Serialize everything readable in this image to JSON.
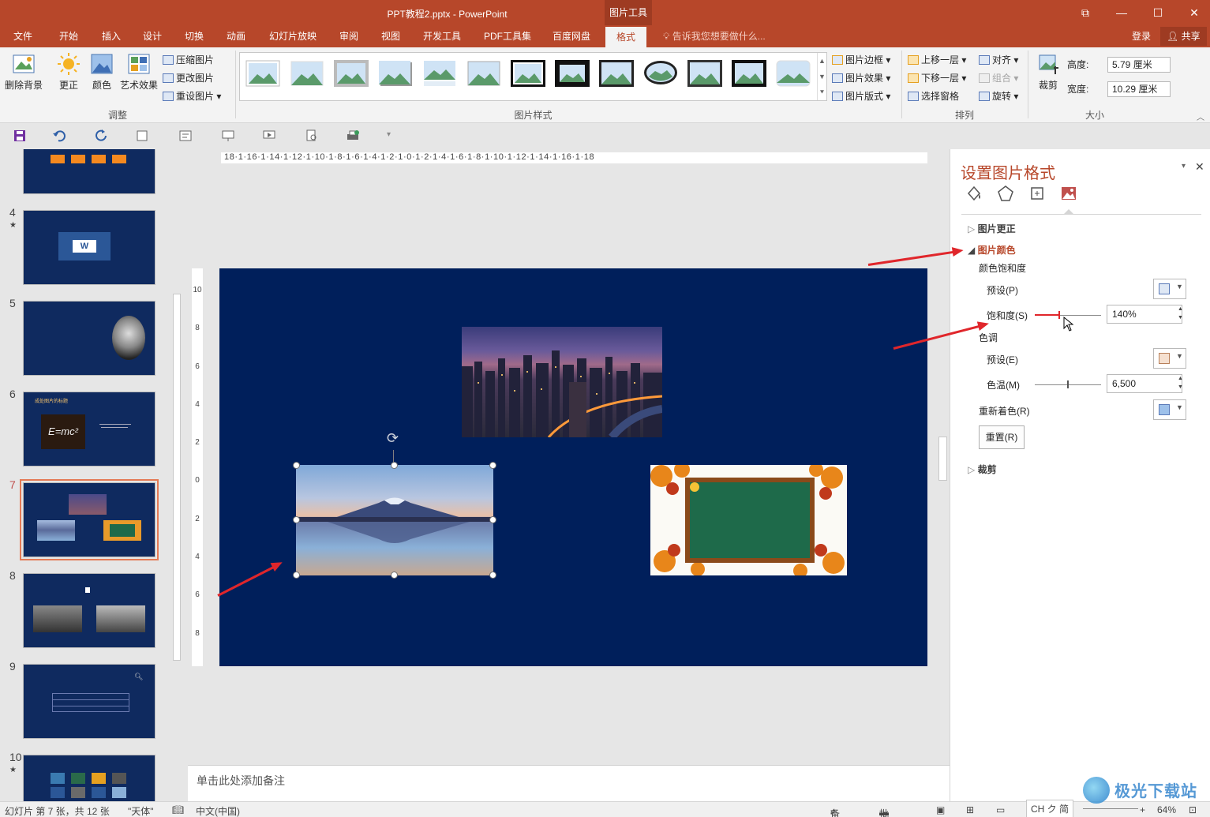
{
  "window": {
    "title": "PPT教程2.pptx - PowerPoint",
    "context_tab": "图片工具",
    "restore_glyph": "⧉",
    "minimize_glyph": "—",
    "maximize_glyph": "☐",
    "close_glyph": "✕"
  },
  "menu": {
    "tabs": [
      "文件",
      "开始",
      "插入",
      "设计",
      "切换",
      "动画",
      "幻灯片放映",
      "审阅",
      "视图",
      "开发工具",
      "PDF工具集",
      "百度网盘",
      "格式"
    ],
    "active": "格式",
    "tell_me": "告诉我您想要做什么...",
    "login": "登录",
    "share": "共享"
  },
  "ribbon": {
    "remove_bg": "删除背景",
    "corrections": "更正",
    "color": "颜色",
    "artistic": "艺术效果",
    "compress": "压缩图片",
    "change": "更改图片",
    "reset": "重设图片",
    "adjust_group": "调整",
    "styles_group": "图片样式",
    "border": "图片边框",
    "effects": "图片效果",
    "layout": "图片版式",
    "bring_forward": "上移一层",
    "send_backward": "下移一层",
    "selection_pane": "选择窗格",
    "align": "对齐",
    "group": "组合",
    "rotate": "旋转",
    "arrange_group": "排列",
    "crop": "裁剪",
    "height_label": "高度:",
    "height_value": "5.79 厘米",
    "width_label": "宽度:",
    "width_value": "10.29 厘米",
    "size_group": "大小"
  },
  "slides": [
    {
      "num": "",
      "star": ""
    },
    {
      "num": "4",
      "star": "★"
    },
    {
      "num": "5",
      "star": ""
    },
    {
      "num": "6",
      "star": ""
    },
    {
      "num": "7",
      "star": ""
    },
    {
      "num": "8",
      "star": ""
    },
    {
      "num": "9",
      "star": ""
    },
    {
      "num": "10",
      "star": "★"
    }
  ],
  "slide6_title": "成处图片的标题",
  "slide6_formula": "E=mc²",
  "ruler_h": "18·1·16·1·14·1·12·1·10·1·8·1·6·1·4·1·2·1·0·1·2·1·4·1·6·1·8·1·10·1·12·1·14·1·16·1·18",
  "ruler_v": [
    "10",
    "8",
    "6",
    "4",
    "2",
    "0",
    "2",
    "4",
    "6",
    "8",
    "10"
  ],
  "notes_placeholder": "单击此处添加备注",
  "pane": {
    "title": "设置图片格式",
    "sections": {
      "correction": "图片更正",
      "color": "图片颜色",
      "crop": "裁剪"
    },
    "saturation_heading": "颜色饱和度",
    "preset_p": "预设(P)",
    "saturation_label": "饱和度(S)",
    "saturation_value": "140%",
    "tone_heading": "色调",
    "preset_e": "预设(E)",
    "temperature_label": "色温(M)",
    "temperature_value": "6,500",
    "recolor_label": "重新着色(R)",
    "reset_button": "重置(R)"
  },
  "status": {
    "slide_info": "幻灯片 第 7 张，共 12 张",
    "theme": "\"天体\"",
    "language": "中文(中国)",
    "notes": "备注",
    "comments": "批注",
    "ime": "CH ク 简",
    "zoom": "64%"
  },
  "watermark": "极光下载站"
}
